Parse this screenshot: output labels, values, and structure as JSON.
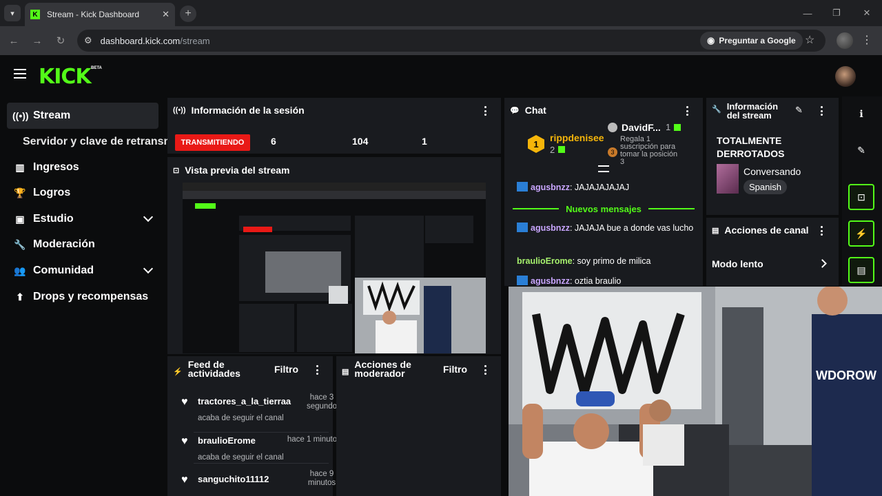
{
  "browser": {
    "tab_title": "Stream - Kick Dashboard",
    "tab_close": "✕",
    "url_host": "dashboard.kick.com",
    "url_path": "/stream",
    "ask_google": "Preguntar a Google",
    "win_min": "—",
    "win_max": "❐",
    "win_close": "✕"
  },
  "header": {
    "logo": "KICK",
    "beta": "BETA"
  },
  "sidebar": {
    "items": [
      {
        "label": "Stream"
      },
      {
        "label": "Ingresos"
      },
      {
        "label": "Logros"
      },
      {
        "label": "Estudio"
      },
      {
        "label": "Moderación"
      },
      {
        "label": "Comunidad"
      },
      {
        "label": "Drops y recompensas"
      }
    ],
    "sub_item": "Servidor y clave de retransm"
  },
  "session": {
    "title": "Información de la sesión",
    "live_badge": "TRANSMITIENDO",
    "stats": [
      "6",
      "104",
      "1"
    ]
  },
  "preview": {
    "title": "Vista previa del stream"
  },
  "chat": {
    "title": "Chat",
    "top_user": "rippdenisee",
    "top_count": "2",
    "top_rank": "1",
    "gift_user": "DavidF...",
    "gift_count": "1",
    "gift_text": "Regala 1 suscripción para tomar la posición 3",
    "gift_rank": "3",
    "messages": [
      {
        "user": "agusbnzz",
        "text": ": JAJAJAJAJAJ"
      },
      {
        "user": "agusbnzz",
        "text": ": JAJAJA bue a donde vas lucho"
      },
      {
        "user": "braulioErome",
        "text": ": soy primo de milica"
      },
      {
        "user": "agusbnzz",
        "text": ": oztia braulio"
      }
    ],
    "new_messages": "Nuevos mensajes"
  },
  "stream_info": {
    "title": "Información del stream",
    "stream_title": "TOTALMENTE DERROTADOS",
    "category": "Conversando",
    "language": "Spanish"
  },
  "channel_actions": {
    "title": "Acciones de canal",
    "slow_mode": "Modo lento"
  },
  "activity_feed": {
    "title": "Feed de actividades",
    "filter": "Filtro",
    "items": [
      {
        "name": "tractores_a_la_tierraa",
        "sub": "acaba de seguir el canal",
        "time": "hace 3 segundo"
      },
      {
        "name": "braulioErome",
        "sub": "acaba de seguir el canal",
        "time": "hace 1 minuto"
      },
      {
        "name": "sanguchito11112",
        "sub": "",
        "time": "hace 9 minutos"
      }
    ]
  },
  "mod_actions": {
    "title": "Acciones de moderador",
    "filter": "Filtro"
  },
  "colors": {
    "accent": "#53fc18",
    "live": "#e91916",
    "panel": "#191b1f",
    "background": "#0b0c0d"
  }
}
